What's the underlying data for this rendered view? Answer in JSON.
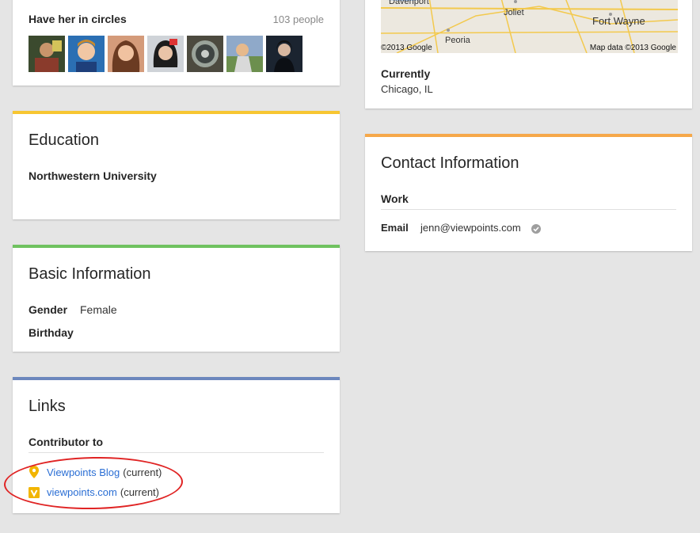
{
  "circles": {
    "title": "Have her in circles",
    "count": "103 people",
    "avatars": [
      "avatar-1",
      "avatar-2",
      "avatar-3",
      "avatar-4",
      "avatar-5",
      "avatar-6",
      "avatar-7"
    ]
  },
  "location": {
    "map_labels": [
      "Davenport",
      "Joliet",
      "Fort Wayne",
      "Peoria"
    ],
    "map_copyright_left": "©2013 Google",
    "map_copyright_right": "Map data ©2013 Google",
    "currently_label": "Currently",
    "currently_value": "Chicago, IL"
  },
  "education": {
    "title": "Education",
    "school": "Northwestern University"
  },
  "basic": {
    "title": "Basic Information",
    "gender_label": "Gender",
    "gender_value": "Female",
    "birthday_label": "Birthday"
  },
  "links": {
    "title": "Links",
    "contributor_label": "Contributor to",
    "items": [
      {
        "name": "Viewpoints Blog",
        "suffix": "(current)",
        "icon": "blogger-pin-icon"
      },
      {
        "name": "viewpoints.com",
        "suffix": "(current)",
        "icon": "viewpoints-v-icon"
      }
    ]
  },
  "contact": {
    "title": "Contact Information",
    "section": "Work",
    "email_label": "Email",
    "email_value": "jenn@viewpoints.com"
  },
  "colors": {
    "education": "#f7c631",
    "basic": "#6fc25f",
    "links": "#6c87bd",
    "contact": "#f6a84a",
    "link": "#2a6ed4",
    "annotation": "#e02424"
  }
}
